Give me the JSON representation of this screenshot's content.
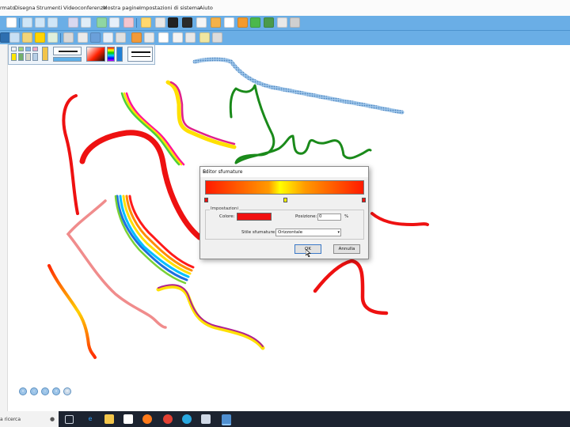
{
  "menu": {
    "items": [
      "rmato",
      "Disegna",
      "Strumenti",
      "Videoconferenze",
      "Mostra pagine",
      "Impostazioni di sistema",
      "Aiuto"
    ]
  },
  "dialog": {
    "title": "Editor sfumature",
    "close_glyph": "×",
    "group_label": "Impostazioni",
    "color_label": "Colore:",
    "position_label": "Posizione:",
    "position_value": "0",
    "position_unit": "%",
    "style_label": "Stile sfumature:",
    "style_value": "Orizzontale",
    "ok_label": "OK",
    "cancel_label": "Annulla",
    "color_value": "#f01010"
  },
  "taskbar": {
    "search_placeholder": "a ricerca"
  },
  "colors": {
    "toolbar": "#6aaee6",
    "taskbar": "#1c2330"
  }
}
